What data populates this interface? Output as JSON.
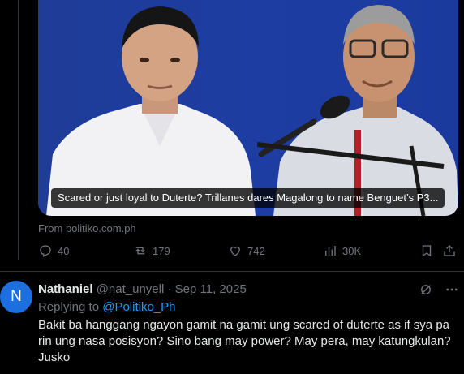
{
  "card": {
    "caption": "Scared or just loyal to Duterte? Trillanes dares Magalong to name Benguet’s P3...",
    "source": "From politiko.com.ph"
  },
  "actions": {
    "replies": "40",
    "reposts": "179",
    "likes": "742",
    "views": "30K"
  },
  "reply": {
    "avatar_letter": "N",
    "name": "Nathaniel",
    "handle": "@nat_unyell",
    "separator": " · ",
    "date": "Sep 11, 2025",
    "replying_to_label": "Replying to ",
    "replying_to": "@Politiko_Ph",
    "text": "Bakit ba hanggang ngayon gamit na gamit ung scared of duterte as if sya pa rin ung nasa posisyon? Sino bang may power? May pera, may katungkulan? Jusko"
  },
  "icons": [
    "reply-icon",
    "repost-icon",
    "like-icon",
    "views-icon",
    "bookmark-icon",
    "share-icon",
    "grok-icon",
    "more-icon"
  ],
  "colors": {
    "accent": "#1d9bf0",
    "muted": "#71767b",
    "avatar": "#1d6fe0",
    "card_bg": "#223f9a"
  }
}
